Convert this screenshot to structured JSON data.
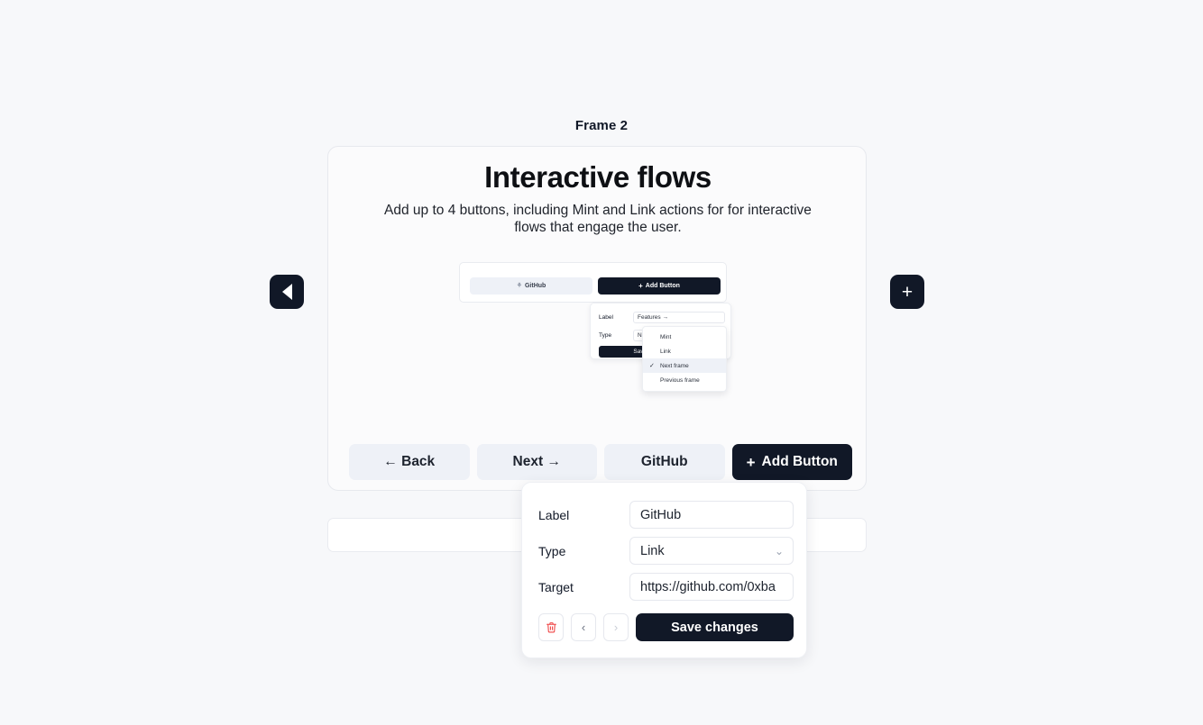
{
  "frame": {
    "label": "Frame 2"
  },
  "card": {
    "title": "Interactive flows",
    "subtitle": "Add up to 4 buttons, including Mint and Link actions for for interactive flows that engage the user."
  },
  "nav": {
    "prev_icon": "triangle-left-icon",
    "add_icon": "plus-icon",
    "add_glyph": "+"
  },
  "mini_preview": {
    "buttons": [
      {
        "label": "GitHub",
        "icon": "github-icon",
        "icon_glyph": "⚘",
        "style": "light"
      },
      {
        "label": "Add Button",
        "icon": "plus-icon",
        "icon_glyph": "+",
        "style": "dark"
      }
    ],
    "panel": {
      "label_field": {
        "label": "Label",
        "value": "Features →"
      },
      "type_field": {
        "label": "Type",
        "value": "Next frame",
        "chevron": "⌄"
      },
      "save_label": "Save changes"
    },
    "dropdown": {
      "options": [
        {
          "label": "Mint",
          "selected": false
        },
        {
          "label": "Link",
          "selected": false
        },
        {
          "label": "Next frame",
          "selected": true
        },
        {
          "label": "Previous frame",
          "selected": false
        }
      ],
      "check_glyph": "✓"
    }
  },
  "main_buttons": [
    {
      "label": "← Back",
      "style": "light"
    },
    {
      "label": "Next →",
      "style": "light"
    },
    {
      "label": "GitHub",
      "style": "light"
    },
    {
      "label": "Add Button",
      "style": "dark",
      "icon": "plus-icon",
      "icon_glyph": "+"
    }
  ],
  "editor": {
    "label_row": {
      "label": "Label",
      "value": "GitHub"
    },
    "type_row": {
      "label": "Type",
      "value": "Link",
      "chevron": "⌄"
    },
    "target_row": {
      "label": "Target",
      "value": "https://github.com/0xba"
    },
    "actions": {
      "delete_icon": "trash-icon",
      "delete_glyph": "🗑",
      "prev_icon": "chevron-left-icon",
      "prev_glyph": "‹",
      "next_icon": "chevron-right-icon",
      "next_glyph": "›",
      "save_label": "Save changes"
    }
  },
  "colors": {
    "page_bg": "#f7f8fa",
    "dark": "#111827",
    "light_btn": "#eef1f7",
    "danger": "#ef4444"
  }
}
